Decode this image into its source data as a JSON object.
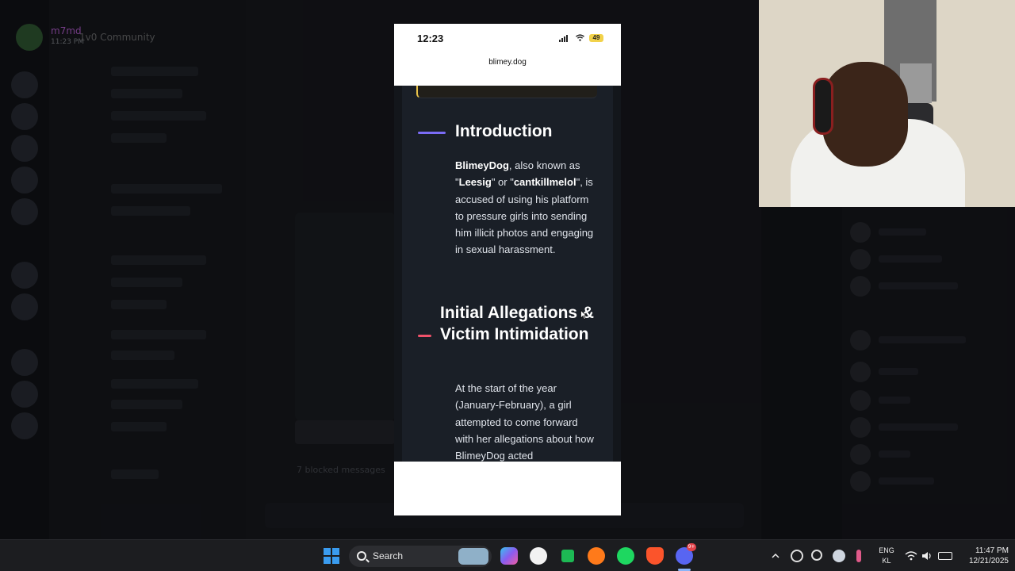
{
  "discord": {
    "user_name": "m7md",
    "user_time": "11:23 PM",
    "server_title": "1v0 Community",
    "blocked_messages": "7 blocked messages",
    "colors": {
      "username": "#c864e6"
    }
  },
  "phone": {
    "status_time": "12:23",
    "battery": "49",
    "url": "blimey.dog",
    "article": {
      "intro_heading": "Introduction",
      "intro_name": "BlimeyDog",
      "intro_text_1": ", also known as \"",
      "alias_1": "Leesig",
      "intro_text_2": "\" or \"",
      "alias_2": "cantkillmelol",
      "intro_text_3": "\", is accused of using his platform to pressure girls into sending him illicit photos and engaging in sexual harassment.",
      "allegations_heading": "Initial Allegations & Victim Intimidation",
      "allegations_text": "At the start of the year (January-February), a girl attempted to come forward with her allegations about how BlimeyDog acted"
    },
    "colors": {
      "accent_intro": "#7b6cf6",
      "accent_allegations": "#f0526a",
      "quote_border": "#e8c24a"
    }
  },
  "webcam": {
    "icon": "webcam-feed"
  },
  "taskbar": {
    "search_label": "Search",
    "discord_badge": "9+",
    "language_line1": "ENG",
    "language_line2": "KL",
    "clock_time": "11:47 PM",
    "clock_date": "12/21/2025",
    "apps": [
      "windows-start-icon",
      "copilot-icon",
      "github-icon",
      "app-icon",
      "firefox-icon",
      "spotify-icon",
      "brave-icon",
      "discord-icon"
    ],
    "tray": [
      "caret-up-icon",
      "sync-icon",
      "obs-icon",
      "steam-icon",
      "mic-icon",
      "wifi-icon",
      "volume-icon",
      "battery-icon"
    ]
  }
}
